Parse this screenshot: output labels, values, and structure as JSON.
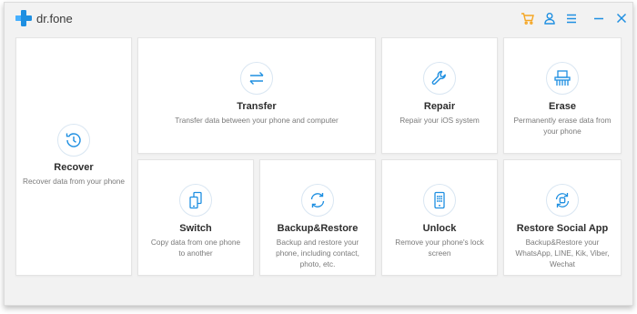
{
  "app": {
    "name": "dr.fone",
    "accent": "#1e8fe1"
  },
  "titlebar": {
    "icons": [
      "cart-icon",
      "user-icon",
      "menu-icon",
      "minimize-icon",
      "close-icon"
    ],
    "cart_color": "#f5a623"
  },
  "cards": {
    "recover": {
      "title": "Recover",
      "desc": "Recover data from your phone",
      "icon": "clock-history-icon"
    },
    "transfer": {
      "title": "Transfer",
      "desc": "Transfer data between your phone and computer",
      "icon": "transfer-arrows-icon"
    },
    "repair": {
      "title": "Repair",
      "desc": "Repair your iOS system",
      "icon": "wrench-icon"
    },
    "erase": {
      "title": "Erase",
      "desc": "Permanently erase data from your phone",
      "icon": "shredder-icon"
    },
    "switch": {
      "title": "Switch",
      "desc": "Copy data from one phone to another",
      "icon": "phones-switch-icon"
    },
    "backup": {
      "title": "Backup&Restore",
      "desc": "Backup and restore your phone, including contact, photo, etc.",
      "icon": "sync-icon"
    },
    "unlock": {
      "title": "Unlock",
      "desc": "Remove your phone's lock screen",
      "icon": "phone-keypad-icon"
    },
    "social": {
      "title": "Restore Social App",
      "desc": "Backup&Restore your WhatsApp, LINE, Kik, Viber, Wechat",
      "icon": "social-restore-icon"
    }
  }
}
